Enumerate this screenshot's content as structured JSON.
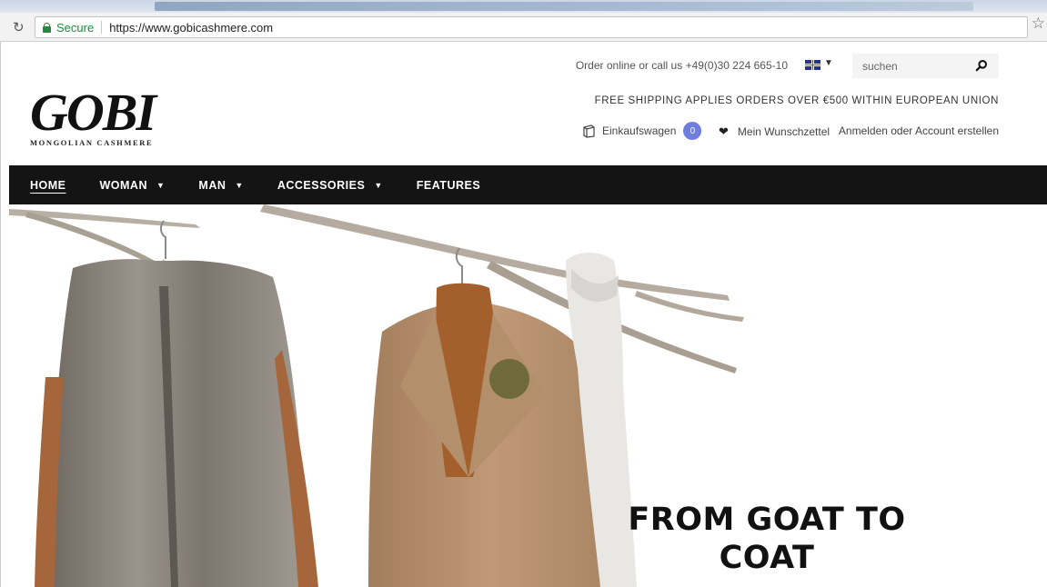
{
  "browser": {
    "secure_label": "Secure",
    "url": "https://www.gobicashmere.com"
  },
  "header": {
    "logo_word": "GOBI",
    "logo_sub": "MONGOLIAN CASHMERE",
    "contact": "Order online or call us +49(0)30 224 665-10",
    "search_placeholder": "suchen",
    "shipping": "FREE SHIPPING APPLIES ORDERS OVER €500 WITHIN EUROPEAN UNION",
    "cart_label": "Einkaufswagen",
    "cart_count": "0",
    "wishlist_label": "Mein Wunschzettel",
    "login_label": "Anmelden oder Account erstellen"
  },
  "nav": {
    "items": [
      {
        "label": "HOME"
      },
      {
        "label": "WOMAN"
      },
      {
        "label": "MAN"
      },
      {
        "label": "ACCESSORIES"
      },
      {
        "label": "FEATURES"
      }
    ]
  },
  "hero": {
    "heading_line1": "FROM GOAT TO",
    "heading_line2": "COAT"
  },
  "colors": {
    "nav_bg": "#141414",
    "cart_badge": "#6f7ddf",
    "secure_green": "#1e8c3a"
  },
  "icons": [
    "reload-icon",
    "lock-icon",
    "star-icon",
    "flag-icon",
    "search-icon",
    "bag-icon",
    "heart-icon"
  ]
}
